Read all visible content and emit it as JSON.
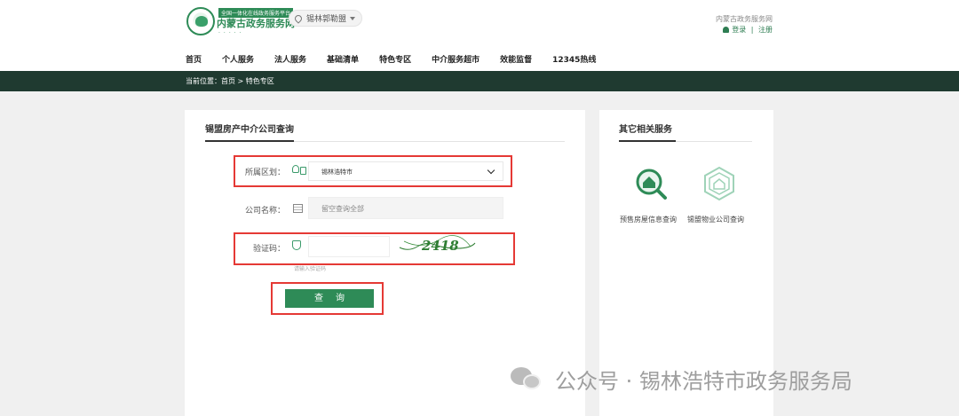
{
  "header": {
    "logo_sub": "全国一体化在线政务服务平台",
    "logo_main": "内蒙古政务服务网",
    "region": "锡林郭勒盟",
    "site_name": "内蒙古政务服务网",
    "login": "登录",
    "separator": "|",
    "register": "注册"
  },
  "nav": [
    "首页",
    "个人服务",
    "法人服务",
    "基础清单",
    "特色专区",
    "中介服务超市",
    "效能监督",
    "12345热线"
  ],
  "breadcrumb": "当前位置：首页 > 特色专区",
  "main": {
    "title": "锡盟房产中介公司查询",
    "district_label": "所属区划：",
    "district_value": "锡林浩特市",
    "company_label": "公司名称：",
    "company_placeholder": "留空查询全部",
    "captcha_label": "验证码：",
    "captcha_code": "2418",
    "captcha_hint": "请输入验证码",
    "query_button": "查询"
  },
  "side": {
    "title": "其它相关服务",
    "items": [
      {
        "label": "预售房屋信息查询",
        "icon": "house-search-icon"
      },
      {
        "label": "锡盟物业公司查询",
        "icon": "property-hexagon-icon"
      }
    ]
  },
  "watermark": "公众号 · 锡林浩特市政务服务局",
  "colors": {
    "brand": "#2e8b57",
    "dark_bar": "#1f3a30",
    "highlight": "#e53935"
  }
}
